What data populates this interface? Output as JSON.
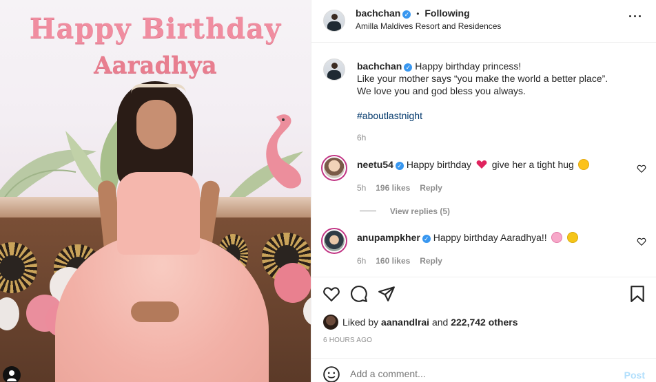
{
  "photo": {
    "headline_line1": "Happy Birthday",
    "headline_line2": "Aaradhya"
  },
  "header": {
    "username": "bachchan",
    "separator": "•",
    "follow_status": "Following",
    "location": "Amilla Maldives Resort and Residences",
    "more_icon": "more-horizontal-icon"
  },
  "caption": {
    "username": "bachchan",
    "line1": "Happy birthday princess!",
    "line2": "Like your mother says “you make the world a better place”.",
    "line3": "We love you and god bless you always.",
    "hashtag": "#aboutlastnight",
    "time": "6h"
  },
  "comments": [
    {
      "username": "neetu54",
      "text_before": "Happy birthday",
      "text_after": "give her a tight hug",
      "time": "5h",
      "likes": "196 likes",
      "reply_label": "Reply",
      "view_replies": "View replies (5)"
    },
    {
      "username": "anupampkher",
      "text": "Happy birthday Aaradhya!!",
      "time": "6h",
      "likes": "160 likes",
      "reply_label": "Reply"
    }
  ],
  "actions": {
    "like_icon": "heart-icon",
    "comment_icon": "comment-icon",
    "share_icon": "send-icon",
    "save_icon": "bookmark-icon"
  },
  "likes": {
    "prefix": "Liked by",
    "user": "aanandlrai",
    "middle": "and",
    "count": "222,742 others"
  },
  "timestamp": "6 HOURS AGO",
  "comment_box": {
    "placeholder": "Add a comment...",
    "post_label": "Post",
    "emoji_icon": "smiley-icon"
  },
  "colors": {
    "verified": "#3897f0",
    "story_ring": "#c13584",
    "post_disabled": "#b2dffc",
    "hashtag": "#00376b"
  }
}
